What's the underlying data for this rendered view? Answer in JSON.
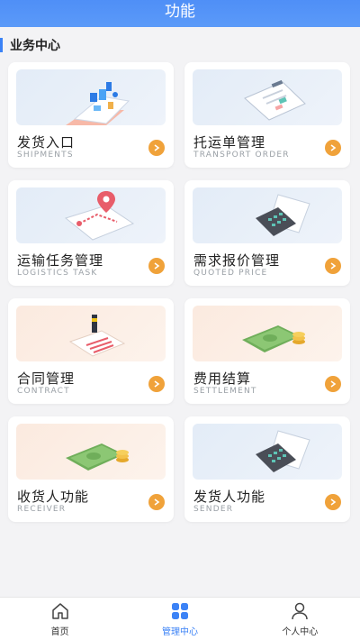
{
  "header": {
    "title": "功能"
  },
  "section": {
    "title": "业务中心"
  },
  "cards": [
    {
      "title": "发货入口",
      "subtitle": "SHIPMENTS",
      "icon": "delivery-illustration-icon"
    },
    {
      "title": "托运单管理",
      "subtitle": "TRANSPORT ORDER",
      "icon": "clipboard-illustration-icon"
    },
    {
      "title": "运输任务管理",
      "subtitle": "LOGISTICS TASK",
      "icon": "map-pin-illustration-icon"
    },
    {
      "title": "需求报价管理",
      "subtitle": "QUOTED PRICE",
      "icon": "calculator-illustration-icon"
    },
    {
      "title": "合同管理",
      "subtitle": "CONTRACT",
      "icon": "contract-illustration-icon"
    },
    {
      "title": "费用结算",
      "subtitle": "SETTLEMENT",
      "icon": "money-illustration-icon"
    },
    {
      "title": "收货人功能",
      "subtitle": "RECEIVER",
      "icon": "money-illustration-icon"
    },
    {
      "title": "发货人功能",
      "subtitle": "SENDER",
      "icon": "calculator-illustration-icon"
    }
  ],
  "tabbar": {
    "items": [
      {
        "label": "首页",
        "icon": "home-icon",
        "active": false
      },
      {
        "label": "管理中心",
        "icon": "grid-icon",
        "active": true
      },
      {
        "label": "个人中心",
        "icon": "user-icon",
        "active": false
      }
    ]
  },
  "colors": {
    "header": "#5b9af8",
    "accent": "#3b82f6",
    "arrow": "#f0a23a"
  }
}
